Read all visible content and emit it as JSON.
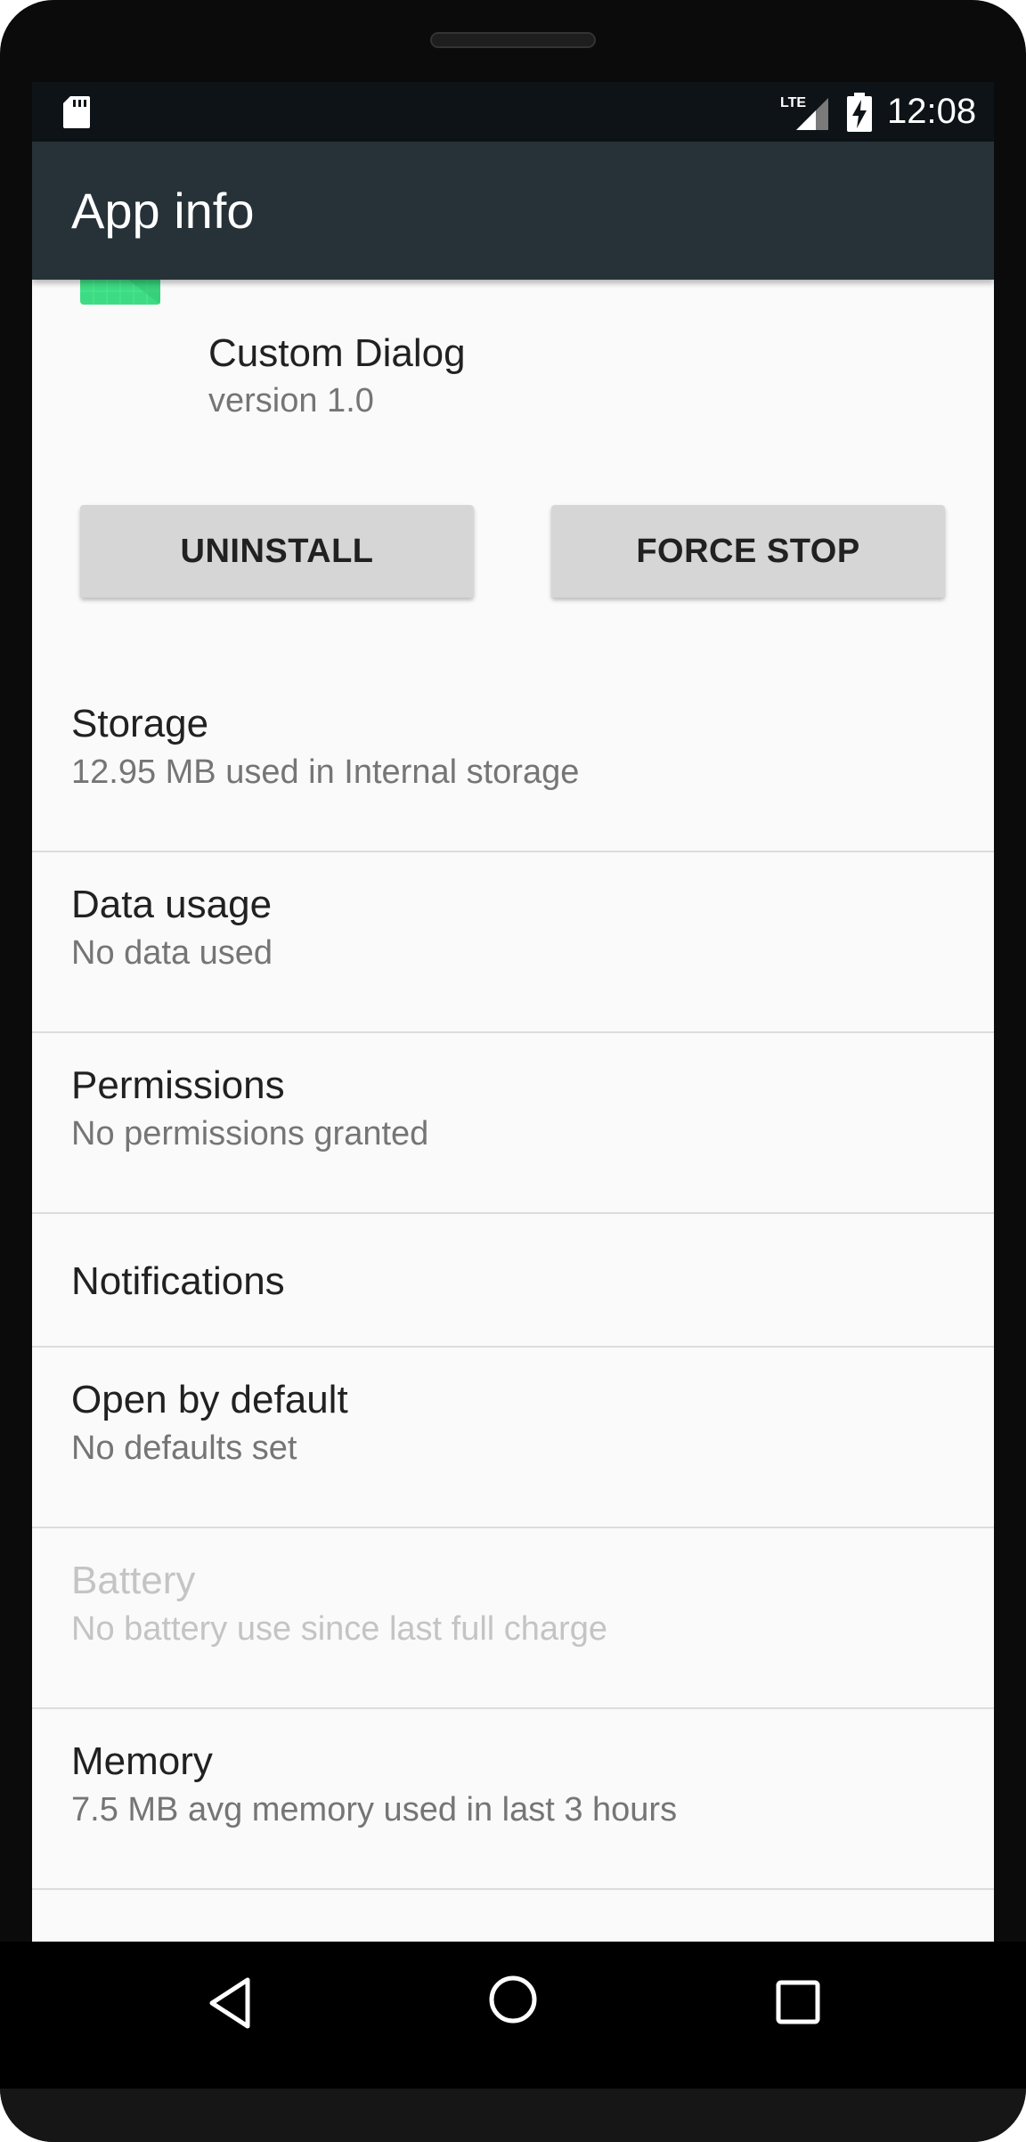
{
  "status_bar": {
    "network_label": "LTE",
    "time": "12:08",
    "icons": [
      "sd-card-icon",
      "lte-signal-icon",
      "battery-charging-icon"
    ]
  },
  "toolbar": {
    "title": "App info"
  },
  "app": {
    "name": "Custom Dialog",
    "version": "version 1.0",
    "icon": "android-app-icon",
    "icon_color": "#3ddc84"
  },
  "buttons": {
    "uninstall": "UNINSTALL",
    "force_stop": "FORCE STOP"
  },
  "preferences": [
    {
      "title": "Storage",
      "summary": "12.95 MB used in Internal storage",
      "enabled": true
    },
    {
      "title": "Data usage",
      "summary": "No data used",
      "enabled": true
    },
    {
      "title": "Permissions",
      "summary": "No permissions granted",
      "enabled": true
    },
    {
      "title": "Notifications",
      "summary": "",
      "enabled": true
    },
    {
      "title": "Open by default",
      "summary": "No defaults set",
      "enabled": true
    },
    {
      "title": "Battery",
      "summary": "No battery use since last full charge",
      "enabled": false
    },
    {
      "title": "Memory",
      "summary": "7.5 MB avg memory used in last 3 hours",
      "enabled": true
    }
  ],
  "nav_bar": {
    "icons": [
      "back-icon",
      "home-icon",
      "recents-icon"
    ]
  },
  "colors": {
    "toolbar": "#263238",
    "status_bar": "#0d1316",
    "background": "#fafafa",
    "button": "#d6d6d6"
  }
}
